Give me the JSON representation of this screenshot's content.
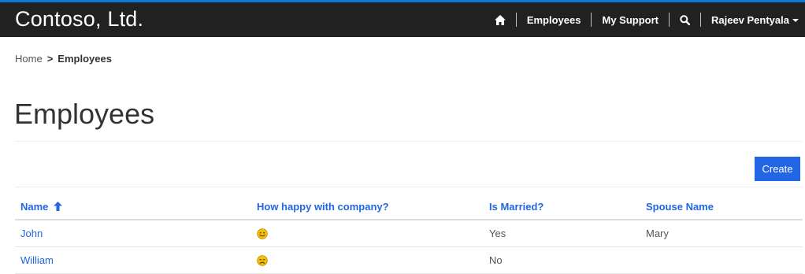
{
  "header": {
    "brand": "Contoso, Ltd.",
    "nav": {
      "home_icon": "home-icon",
      "employees": "Employees",
      "my_support": "My Support",
      "search_icon": "search-icon",
      "user": "Rajeev Pentyala"
    },
    "colors": {
      "bar": "#212121",
      "accent": "#0a78d8"
    }
  },
  "breadcrumb": {
    "home": "Home",
    "separator": ">",
    "current": "Employees"
  },
  "page": {
    "title": "Employees",
    "create_label": "Create",
    "accent_color": "#2266e3"
  },
  "table": {
    "columns": [
      {
        "label": "Name",
        "sort": "ascending"
      },
      {
        "label": "How happy with company?"
      },
      {
        "label": "Is Married?"
      },
      {
        "label": "Spouse Name"
      }
    ],
    "rows": [
      {
        "name": "John",
        "happiness_icon": "smiling-face-icon",
        "married": "Yes",
        "spouse": "Mary"
      },
      {
        "name": "William",
        "happiness_icon": "unhappy-face-icon",
        "married": "No",
        "spouse": ""
      }
    ]
  }
}
